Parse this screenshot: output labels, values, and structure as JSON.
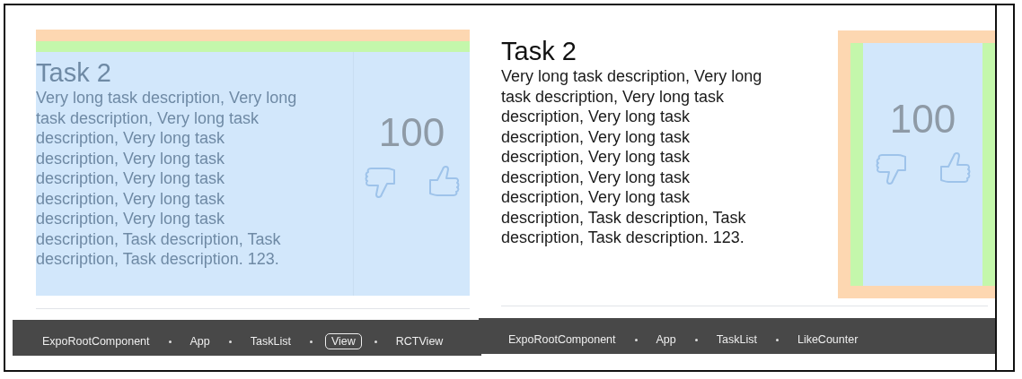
{
  "panels": [
    {
      "task": {
        "highlighted": true,
        "counter_highlighted": false,
        "title": "Task 2",
        "description": "Very long task description, Very long task description, Very long task description, Very long task description, Very long task description, Very long task description, Very long task description, Very long task description, Task description, Task description, Task description. 123.",
        "count": "100"
      },
      "breadcrumbs": [
        {
          "label": "ExpoRootComponent",
          "selected": false
        },
        {
          "label": "App",
          "selected": false
        },
        {
          "label": "TaskList",
          "selected": false
        },
        {
          "label": "View",
          "selected": true
        },
        {
          "label": "RCTView",
          "selected": false
        }
      ]
    },
    {
      "task": {
        "highlighted": false,
        "counter_highlighted": true,
        "title": "Task 2",
        "description": "Very long task description, Very long task description, Very long task description, Very long task description, Very long task description, Very long task description, Very long task description, Very long task description, Task description, Task description, Task description. 123.",
        "count": "100"
      },
      "breadcrumbs": [
        {
          "label": "ExpoRootComponent",
          "selected": false
        },
        {
          "label": "App",
          "selected": false
        },
        {
          "label": "TaskList",
          "selected": false
        },
        {
          "label": "LikeCounter",
          "selected": false
        }
      ]
    }
  ]
}
